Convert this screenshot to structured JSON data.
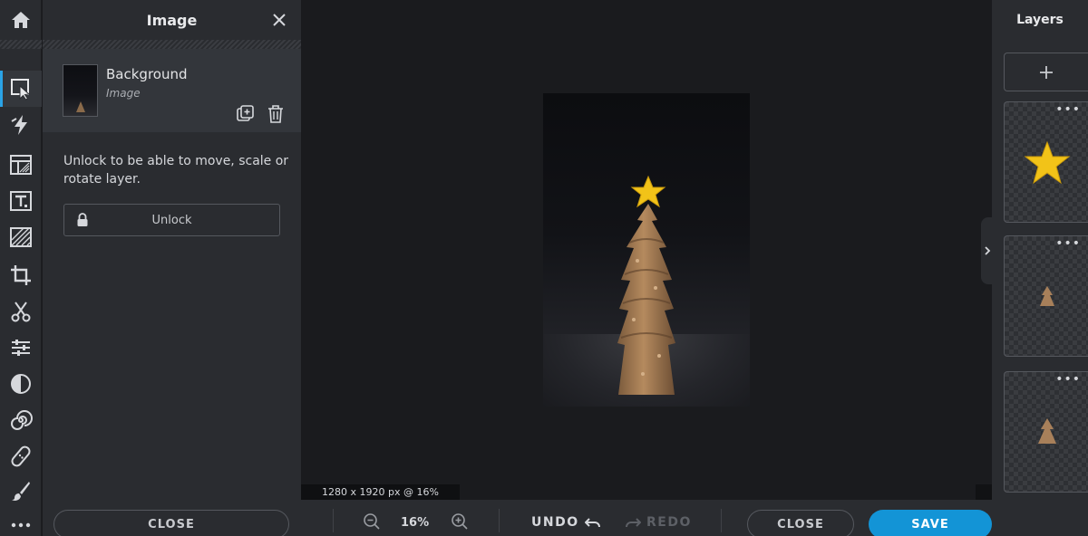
{
  "tool_rail": {
    "tools": [
      {
        "name": "arrange-tool",
        "icon": "select-arrow-icon"
      },
      {
        "name": "quick-fix-tool",
        "icon": "lightning-icon"
      },
      {
        "name": "layout-tool",
        "icon": "layout-icon"
      },
      {
        "name": "text-tool",
        "icon": "text-icon"
      },
      {
        "name": "pattern-tool",
        "icon": "pattern-icon"
      },
      {
        "name": "crop-tool",
        "icon": "crop-icon"
      },
      {
        "name": "cutout-tool",
        "icon": "scissors-icon"
      },
      {
        "name": "adjust-tool",
        "icon": "sliders-icon"
      },
      {
        "name": "filter-tool",
        "icon": "contrast-icon"
      },
      {
        "name": "effects-tool",
        "icon": "spiral-icon"
      },
      {
        "name": "retouch-tool",
        "icon": "bandage-icon"
      },
      {
        "name": "draw-tool",
        "icon": "brush-icon"
      },
      {
        "name": "more-tools",
        "icon": "more-dots-icon"
      }
    ],
    "active_index": 0
  },
  "panel": {
    "title": "Image",
    "layer_name": "Background",
    "layer_type": "Image",
    "message": "Unlock to be able to move, scale or rotate layer.",
    "unlock_label": "Unlock",
    "close_label": "CLOSE"
  },
  "canvas": {
    "dimensions_text": "1280 x 1920 px @ 16%"
  },
  "bottom_bar": {
    "zoom_value": "16%",
    "undo_label": "UNDO",
    "redo_label": "REDO",
    "close_label": "CLOSE",
    "save_label": "SAVE"
  },
  "layers": {
    "title": "Layers",
    "items": [
      {
        "name": "star-layer",
        "dots": "•••"
      },
      {
        "name": "tree-small-layer",
        "dots": "•••"
      },
      {
        "name": "tree-layer",
        "dots": "•••"
      }
    ]
  },
  "colors": {
    "accent": "#1394d6",
    "active_indicator": "#2aa3e6",
    "panel_bg": "#2a2c30",
    "canvas_bg": "#1a1b1e",
    "star": "#f2c318"
  }
}
